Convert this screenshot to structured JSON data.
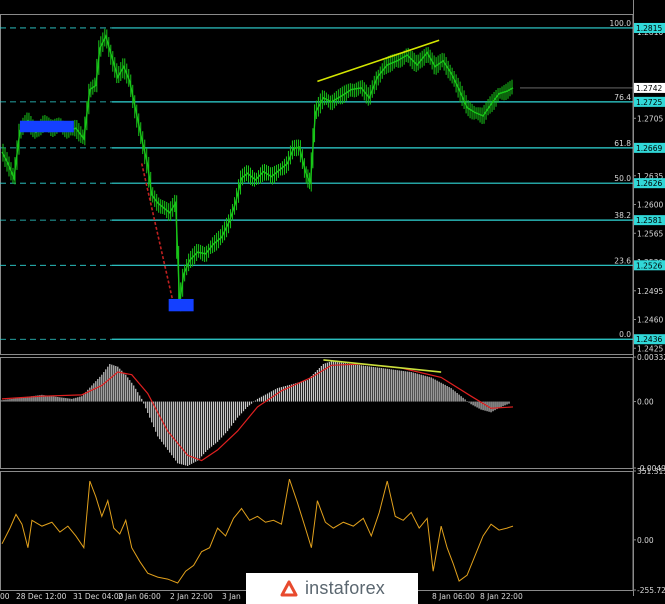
{
  "chart_data": [
    {
      "type": "candlestick",
      "panel": "price",
      "ylim": [
        1.2418,
        1.2832
      ],
      "price_axis_labels": [
        "1.2810",
        "1.2742",
        "1.2705",
        "1.2635",
        "1.2600",
        "1.2565",
        "1.2530",
        "1.2495",
        "1.2460",
        "1.2425"
      ],
      "fibonacci_levels": [
        {
          "label": "100.0",
          "value": 1.2815
        },
        {
          "label": "76.4",
          "value": 1.2725
        },
        {
          "label": "61.8",
          "value": 1.2669
        },
        {
          "label": "50.0",
          "value": 1.2626
        },
        {
          "label": "38.2",
          "value": 1.2581
        },
        {
          "label": "23.6",
          "value": 1.2526
        },
        {
          "label": "0.0",
          "value": 1.2436
        }
      ],
      "level_tags": [
        {
          "value": 1.2815,
          "text": "1.2815"
        },
        {
          "value": 1.2725,
          "text": "1.2725"
        },
        {
          "value": 1.2669,
          "text": "1.2669"
        },
        {
          "value": 1.2626,
          "text": "1.2626"
        },
        {
          "value": 1.2581,
          "text": "1.2581"
        },
        {
          "value": 1.2526,
          "text": "1.2526"
        },
        {
          "value": 1.2436,
          "text": "1.2436"
        }
      ],
      "current_price": {
        "value": 1.2742,
        "text": "1.2742"
      },
      "close_path": [
        {
          "t": 0,
          "v": 1.2664
        },
        {
          "t": 6,
          "v": 1.265
        },
        {
          "t": 12,
          "v": 1.2632
        },
        {
          "t": 18,
          "v": 1.269
        },
        {
          "t": 26,
          "v": 1.2702
        },
        {
          "t": 34,
          "v": 1.2688
        },
        {
          "t": 42,
          "v": 1.27
        },
        {
          "t": 50,
          "v": 1.2692
        },
        {
          "t": 58,
          "v": 1.2698
        },
        {
          "t": 66,
          "v": 1.269
        },
        {
          "t": 74,
          "v": 1.2693
        },
        {
          "t": 82,
          "v": 1.268
        },
        {
          "t": 88,
          "v": 1.274
        },
        {
          "t": 94,
          "v": 1.2745
        },
        {
          "t": 98,
          "v": 1.279
        },
        {
          "t": 104,
          "v": 1.2805
        },
        {
          "t": 110,
          "v": 1.278
        },
        {
          "t": 116,
          "v": 1.2755
        },
        {
          "t": 122,
          "v": 1.2768
        },
        {
          "t": 128,
          "v": 1.275
        },
        {
          "t": 134,
          "v": 1.2715
        },
        {
          "t": 140,
          "v": 1.268
        },
        {
          "t": 146,
          "v": 1.2648
        },
        {
          "t": 150,
          "v": 1.2612
        },
        {
          "t": 156,
          "v": 1.2602
        },
        {
          "t": 162,
          "v": 1.2596
        },
        {
          "t": 168,
          "v": 1.259
        },
        {
          "t": 174,
          "v": 1.2602
        },
        {
          "t": 178,
          "v": 1.248
        },
        {
          "t": 182,
          "v": 1.2515
        },
        {
          "t": 188,
          "v": 1.2532
        },
        {
          "t": 196,
          "v": 1.2542
        },
        {
          "t": 204,
          "v": 1.254
        },
        {
          "t": 212,
          "v": 1.2552
        },
        {
          "t": 220,
          "v": 1.256
        },
        {
          "t": 228,
          "v": 1.258
        },
        {
          "t": 234,
          "v": 1.2602
        },
        {
          "t": 240,
          "v": 1.2632
        },
        {
          "t": 246,
          "v": 1.2638
        },
        {
          "t": 254,
          "v": 1.263
        },
        {
          "t": 262,
          "v": 1.264
        },
        {
          "t": 270,
          "v": 1.2634
        },
        {
          "t": 278,
          "v": 1.2642
        },
        {
          "t": 286,
          "v": 1.265
        },
        {
          "t": 292,
          "v": 1.2668
        },
        {
          "t": 298,
          "v": 1.267
        },
        {
          "t": 304,
          "v": 1.264
        },
        {
          "t": 309,
          "v": 1.2625
        },
        {
          "t": 314,
          "v": 1.2712
        },
        {
          "t": 322,
          "v": 1.273
        },
        {
          "t": 330,
          "v": 1.2725
        },
        {
          "t": 340,
          "v": 1.2732
        },
        {
          "t": 350,
          "v": 1.274
        },
        {
          "t": 360,
          "v": 1.2742
        },
        {
          "t": 368,
          "v": 1.273
        },
        {
          "t": 376,
          "v": 1.2755
        },
        {
          "t": 386,
          "v": 1.277
        },
        {
          "t": 396,
          "v": 1.2775
        },
        {
          "t": 406,
          "v": 1.2782
        },
        {
          "t": 416,
          "v": 1.277
        },
        {
          "t": 426,
          "v": 1.2785
        },
        {
          "t": 434,
          "v": 1.2768
        },
        {
          "t": 442,
          "v": 1.2775
        },
        {
          "t": 450,
          "v": 1.276
        },
        {
          "t": 458,
          "v": 1.274
        },
        {
          "t": 466,
          "v": 1.2718
        },
        {
          "t": 474,
          "v": 1.2712
        },
        {
          "t": 482,
          "v": 1.2708
        },
        {
          "t": 490,
          "v": 1.2722
        },
        {
          "t": 498,
          "v": 1.2735
        },
        {
          "t": 506,
          "v": 1.2738
        },
        {
          "t": 512,
          "v": 1.2742
        }
      ],
      "trendlines": [
        {
          "color": "#d4e600",
          "points": [
            [
              316,
              1.275
            ],
            [
              438,
              1.28
            ]
          ]
        },
        {
          "color": "#c02020",
          "dashed": true,
          "points": [
            [
              140,
              1.265
            ],
            [
              172,
              1.2478
            ]
          ]
        }
      ],
      "markers": [
        {
          "color": "#1440ff",
          "t0": 18,
          "t1": 72,
          "v0": 1.2688,
          "v1": 1.2702,
          "glyphs": "▲▲▲▲▲▲▲"
        },
        {
          "color": "#1440ff",
          "t0": 167,
          "t1": 192,
          "v0": 1.247,
          "v1": 1.2485,
          "glyphs": "▲▲▲"
        }
      ],
      "x_axis_labels": [
        "28 Dec 12:00",
        "31 Dec 04:00",
        "2 Jan 06:00",
        "2 Jan 22:00",
        "8 Jan 06:00",
        "8 Jan 22:00"
      ],
      "x_axis_labels_partial": [
        "00",
        "3 Jan"
      ]
    },
    {
      "type": "bar+line",
      "panel": "oscillator",
      "ylim": [
        -0.00495,
        0.00332
      ],
      "axis_labels": [
        "0.00332",
        "0.00",
        "-0.00495"
      ],
      "histogram": [
        {
          "t": 0,
          "v": 0.0001
        },
        {
          "t": 10,
          "v": 0.0002
        },
        {
          "t": 20,
          "v": 0.0003
        },
        {
          "t": 30,
          "v": 0.0004
        },
        {
          "t": 40,
          "v": 0.0005
        },
        {
          "t": 50,
          "v": 0.0004
        },
        {
          "t": 60,
          "v": 0.0003
        },
        {
          "t": 70,
          "v": 0.0002
        },
        {
          "t": 80,
          "v": 0.0004
        },
        {
          "t": 90,
          "v": 0.0012
        },
        {
          "t": 100,
          "v": 0.002
        },
        {
          "t": 108,
          "v": 0.0028
        },
        {
          "t": 116,
          "v": 0.0026
        },
        {
          "t": 124,
          "v": 0.002
        },
        {
          "t": 132,
          "v": 0.0012
        },
        {
          "t": 140,
          "v": 0.0002
        },
        {
          "t": 148,
          "v": -0.0012
        },
        {
          "t": 156,
          "v": -0.0026
        },
        {
          "t": 166,
          "v": -0.0036
        },
        {
          "t": 176,
          "v": -0.0046
        },
        {
          "t": 186,
          "v": -0.0048
        },
        {
          "t": 196,
          "v": -0.0044
        },
        {
          "t": 206,
          "v": -0.0036
        },
        {
          "t": 216,
          "v": -0.003
        },
        {
          "t": 226,
          "v": -0.0022
        },
        {
          "t": 236,
          "v": -0.0012
        },
        {
          "t": 246,
          "v": -0.0004
        },
        {
          "t": 256,
          "v": 0.0002
        },
        {
          "t": 266,
          "v": 0.0006
        },
        {
          "t": 276,
          "v": 0.001
        },
        {
          "t": 286,
          "v": 0.0012
        },
        {
          "t": 296,
          "v": 0.0014
        },
        {
          "t": 306,
          "v": 0.0016
        },
        {
          "t": 314,
          "v": 0.0022
        },
        {
          "t": 322,
          "v": 0.0028
        },
        {
          "t": 330,
          "v": 0.003
        },
        {
          "t": 340,
          "v": 0.0029
        },
        {
          "t": 350,
          "v": 0.0028
        },
        {
          "t": 360,
          "v": 0.0027
        },
        {
          "t": 370,
          "v": 0.0026
        },
        {
          "t": 380,
          "v": 0.0025
        },
        {
          "t": 390,
          "v": 0.0024
        },
        {
          "t": 400,
          "v": 0.0023
        },
        {
          "t": 410,
          "v": 0.0022
        },
        {
          "t": 420,
          "v": 0.002
        },
        {
          "t": 430,
          "v": 0.0018
        },
        {
          "t": 440,
          "v": 0.0014
        },
        {
          "t": 450,
          "v": 0.001
        },
        {
          "t": 460,
          "v": 0.0004
        },
        {
          "t": 470,
          "v": -0.0002
        },
        {
          "t": 480,
          "v": -0.0006
        },
        {
          "t": 490,
          "v": -0.0008
        },
        {
          "t": 500,
          "v": -0.0004
        },
        {
          "t": 510,
          "v": -0.0001
        }
      ],
      "signal_line": [
        {
          "t": 0,
          "v": 0.0002
        },
        {
          "t": 40,
          "v": 0.0004
        },
        {
          "t": 80,
          "v": 0.0005
        },
        {
          "t": 100,
          "v": 0.0012
        },
        {
          "t": 116,
          "v": 0.0022
        },
        {
          "t": 130,
          "v": 0.002
        },
        {
          "t": 146,
          "v": 0.0006
        },
        {
          "t": 166,
          "v": -0.0022
        },
        {
          "t": 186,
          "v": -0.004
        },
        {
          "t": 200,
          "v": -0.0044
        },
        {
          "t": 216,
          "v": -0.0036
        },
        {
          "t": 236,
          "v": -0.0022
        },
        {
          "t": 256,
          "v": -0.0004
        },
        {
          "t": 280,
          "v": 0.0008
        },
        {
          "t": 310,
          "v": 0.0018
        },
        {
          "t": 330,
          "v": 0.0027
        },
        {
          "t": 360,
          "v": 0.0028
        },
        {
          "t": 400,
          "v": 0.0025
        },
        {
          "t": 440,
          "v": 0.0018
        },
        {
          "t": 470,
          "v": 0.0004
        },
        {
          "t": 490,
          "v": -0.0005
        },
        {
          "t": 512,
          "v": -0.0004
        }
      ],
      "trendline": {
        "color": "#c8e03c",
        "points": [
          [
            322,
            0.0031
          ],
          [
            440,
            0.0022
          ]
        ]
      }
    },
    {
      "type": "line",
      "panel": "oscillator",
      "ylim": [
        -255.723,
        351.3137
      ],
      "axis_labels": [
        "351.3137",
        "0.00",
        "-255.723"
      ],
      "series": [
        {
          "color": "#e2a11c",
          "points": [
            {
              "t": 0,
              "v": -20
            },
            {
              "t": 8,
              "v": 60
            },
            {
              "t": 14,
              "v": 130
            },
            {
              "t": 20,
              "v": 80
            },
            {
              "t": 26,
              "v": -40
            },
            {
              "t": 30,
              "v": 100
            },
            {
              "t": 40,
              "v": 70
            },
            {
              "t": 50,
              "v": 90
            },
            {
              "t": 58,
              "v": 40
            },
            {
              "t": 66,
              "v": 70
            },
            {
              "t": 74,
              "v": 20
            },
            {
              "t": 82,
              "v": -40
            },
            {
              "t": 88,
              "v": 300
            },
            {
              "t": 94,
              "v": 220
            },
            {
              "t": 100,
              "v": 120
            },
            {
              "t": 106,
              "v": 200
            },
            {
              "t": 112,
              "v": 60
            },
            {
              "t": 118,
              "v": 30
            },
            {
              "t": 124,
              "v": 100
            },
            {
              "t": 130,
              "v": -40
            },
            {
              "t": 138,
              "v": -110
            },
            {
              "t": 146,
              "v": -170
            },
            {
              "t": 156,
              "v": -190
            },
            {
              "t": 166,
              "v": -200
            },
            {
              "t": 176,
              "v": -220
            },
            {
              "t": 184,
              "v": -160
            },
            {
              "t": 192,
              "v": -130
            },
            {
              "t": 200,
              "v": -60
            },
            {
              "t": 208,
              "v": -40
            },
            {
              "t": 216,
              "v": 60
            },
            {
              "t": 224,
              "v": 20
            },
            {
              "t": 232,
              "v": 110
            },
            {
              "t": 240,
              "v": 160
            },
            {
              "t": 248,
              "v": 100
            },
            {
              "t": 256,
              "v": 120
            },
            {
              "t": 264,
              "v": 90
            },
            {
              "t": 272,
              "v": 100
            },
            {
              "t": 280,
              "v": 80
            },
            {
              "t": 288,
              "v": 310
            },
            {
              "t": 296,
              "v": 190
            },
            {
              "t": 304,
              "v": 60
            },
            {
              "t": 310,
              "v": -40
            },
            {
              "t": 316,
              "v": 200
            },
            {
              "t": 324,
              "v": 90
            },
            {
              "t": 332,
              "v": 60
            },
            {
              "t": 342,
              "v": 90
            },
            {
              "t": 352,
              "v": 70
            },
            {
              "t": 362,
              "v": 110
            },
            {
              "t": 370,
              "v": 20
            },
            {
              "t": 378,
              "v": 140
            },
            {
              "t": 386,
              "v": 300
            },
            {
              "t": 394,
              "v": 120
            },
            {
              "t": 402,
              "v": 100
            },
            {
              "t": 410,
              "v": 140
            },
            {
              "t": 418,
              "v": 60
            },
            {
              "t": 426,
              "v": 110
            },
            {
              "t": 432,
              "v": -160
            },
            {
              "t": 440,
              "v": 70
            },
            {
              "t": 446,
              "v": -40
            },
            {
              "t": 452,
              "v": -120
            },
            {
              "t": 458,
              "v": -210
            },
            {
              "t": 466,
              "v": -180
            },
            {
              "t": 474,
              "v": -80
            },
            {
              "t": 482,
              "v": 20
            },
            {
              "t": 490,
              "v": 80
            },
            {
              "t": 498,
              "v": 50
            },
            {
              "t": 506,
              "v": 60
            },
            {
              "t": 512,
              "v": 70
            }
          ]
        }
      ]
    }
  ],
  "watermark": {
    "text": "instaforex"
  }
}
